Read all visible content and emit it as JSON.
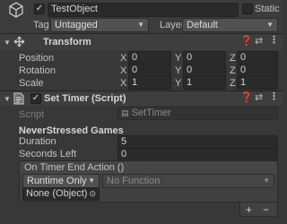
{
  "header": {
    "object_name": "TestObject",
    "static_label": "Static",
    "tag_label": "Tag",
    "tag_value": "Untagged",
    "layer_label": "Layer",
    "layer_value": "Default"
  },
  "transform": {
    "title": "Transform",
    "rows": [
      {
        "label": "Position",
        "x": "0",
        "y": "0",
        "z": "0"
      },
      {
        "label": "Rotation",
        "x": "0",
        "y": "0",
        "z": "0"
      },
      {
        "label": "Scale",
        "x": "1",
        "y": "1",
        "z": "1"
      }
    ],
    "axis": {
      "x": "X",
      "y": "Y",
      "z": "Z"
    }
  },
  "set_timer": {
    "title": "Set Timer (Script)",
    "script_label": "Script",
    "script_value": "SetTimer",
    "section_title": "NeverStressed Games",
    "duration_label": "Duration",
    "duration_value": "5",
    "seconds_left_label": "Seconds Left",
    "seconds_left_value": "0",
    "event_title": "On Timer End Action ()",
    "runtime_value": "Runtime Only",
    "function_value": "No Function",
    "object_value": "None (Object)",
    "add_label": "+",
    "remove_label": "−"
  }
}
